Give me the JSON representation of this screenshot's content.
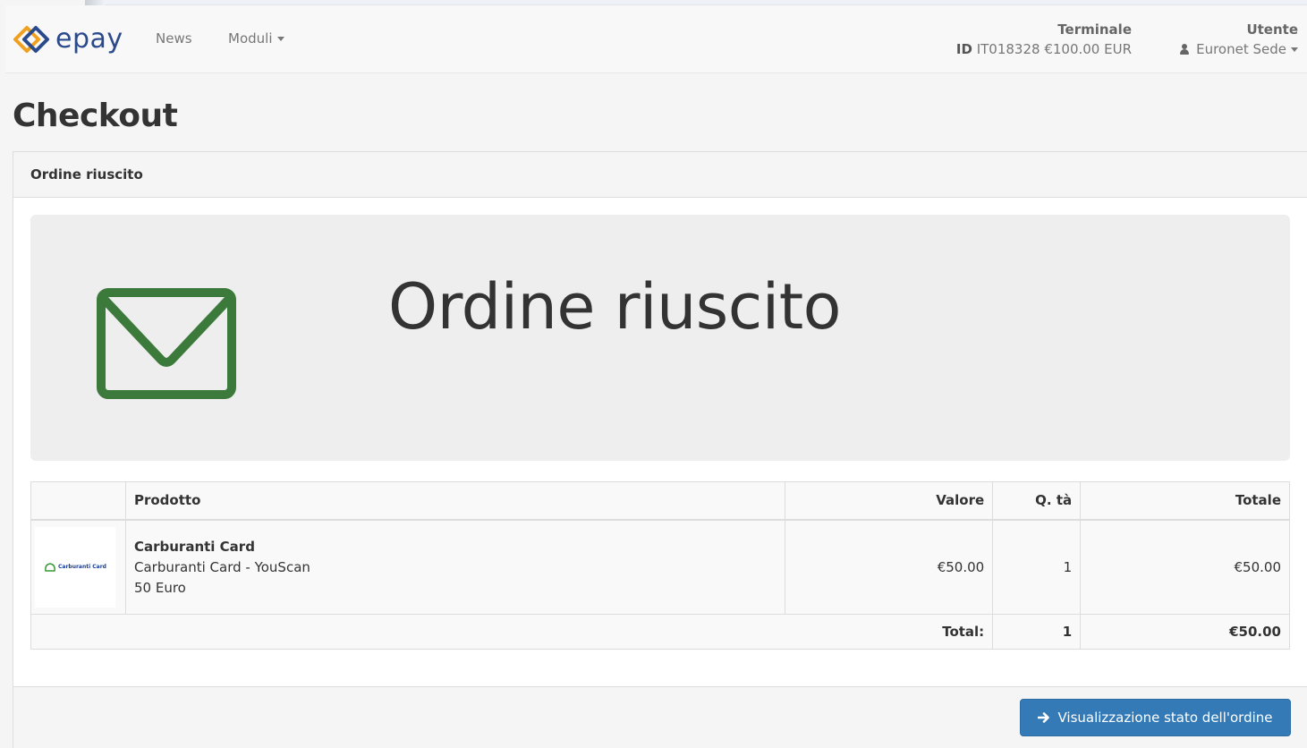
{
  "header": {
    "brand": "epay",
    "nav": [
      {
        "label": "News"
      },
      {
        "label": "Moduli"
      }
    ],
    "terminal": {
      "label": "Terminale",
      "id_prefix": "ID",
      "value": "IT018328 €100.00 EUR"
    },
    "user": {
      "label": "Utente",
      "name": "Euronet Sede"
    }
  },
  "page": {
    "title": "Checkout"
  },
  "panel": {
    "heading": "Ordine riuscito",
    "jumbotron_title": "Ordine riuscito",
    "icon": "envelope-icon",
    "icon_color": "#3c7a3c"
  },
  "table": {
    "columns": {
      "image": "",
      "product": "Prodotto",
      "value": "Valore",
      "qty": "Q. tà",
      "total": "Totale"
    },
    "rows": [
      {
        "thumb_text": "Carburanti Card",
        "name": "Carburanti Card",
        "subtitle": "Carburanti Card - YouScan",
        "denomination": "50 Euro",
        "value": "€50.00",
        "qty": "1",
        "total": "€50.00"
      }
    ],
    "footer": {
      "label": "Total:",
      "qty": "1",
      "total": "€50.00"
    }
  },
  "footer": {
    "button_label": "Visualizzazione stato dell'ordine"
  },
  "colors": {
    "primary": "#337ab7",
    "brand": "#2b4a8c",
    "success_icon": "#3c7a3c"
  }
}
